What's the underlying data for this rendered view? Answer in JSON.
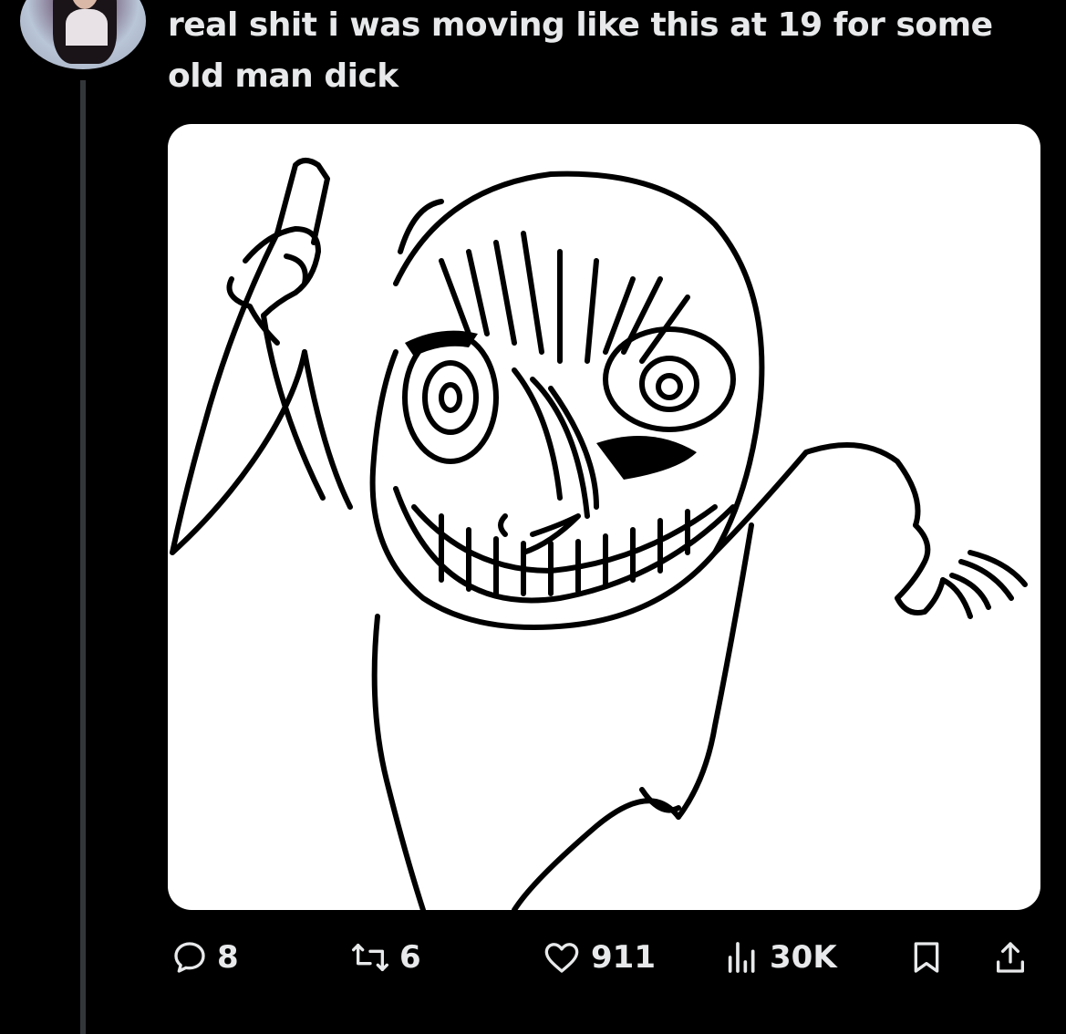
{
  "tweet": {
    "text": "real shit i was moving like this at 19 for some old man dick"
  },
  "actions": {
    "replies": "8",
    "retweets": "6",
    "likes": "911",
    "views": "30K"
  },
  "icons": {
    "reply": "reply-icon",
    "retweet": "retweet-icon",
    "like": "heart-icon",
    "views": "views-icon",
    "bookmark": "bookmark-icon",
    "share": "share-icon"
  },
  "colors": {
    "background": "#000000",
    "text": "#e7e9ea",
    "thread_line": "#333639",
    "media_background": "#ffffff"
  }
}
